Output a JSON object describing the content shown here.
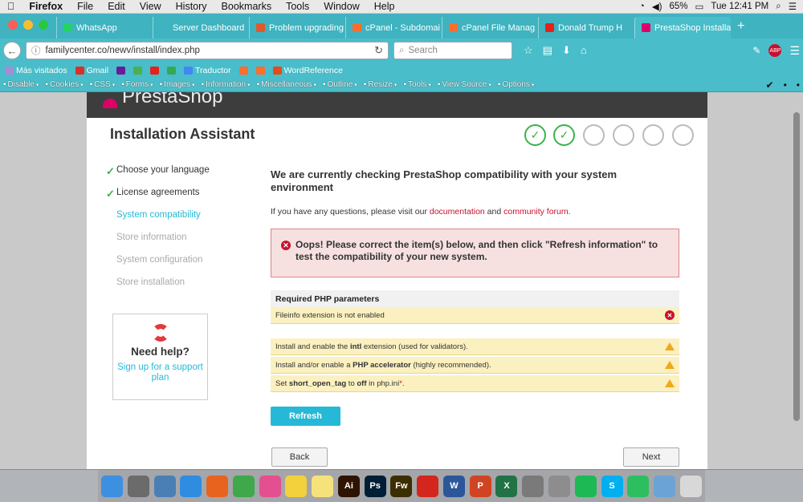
{
  "menubar": {
    "app": "Firefox",
    "items": [
      "File",
      "Edit",
      "View",
      "History",
      "Bookmarks",
      "Tools",
      "Window",
      "Help"
    ],
    "battery": "65%",
    "clock": "Tue 12:41 PM"
  },
  "tabs": [
    {
      "label": "WhatsApp",
      "color": "#25d366"
    },
    {
      "label": "Server Dashboard",
      "color": ""
    },
    {
      "label": "Problem upgrading",
      "color": "#de5a2c"
    },
    {
      "label": "cPanel - Subdomai",
      "color": "#ff6c2c"
    },
    {
      "label": "cPanel File Manag",
      "color": "#ff6c2c"
    },
    {
      "label": "Donald Trump H",
      "color": "#e62117"
    },
    {
      "label": "PrestaShop Installa",
      "color": "#df0067"
    }
  ],
  "navbar": {
    "url": "familycenter.co/newv/install/index.php",
    "search_placeholder": "Search"
  },
  "bookmarks": [
    {
      "label": "Más visitados",
      "color": "#a88bd8"
    },
    {
      "label": "Gmail",
      "color": "#d93025"
    },
    {
      "label": "",
      "color": "#6a1b9a"
    },
    {
      "label": "",
      "color": "#4caf50"
    },
    {
      "label": "",
      "color": "#e62117"
    },
    {
      "label": "",
      "color": "#34a853"
    },
    {
      "label": "Traductor",
      "color": "#4285f4"
    },
    {
      "label": "",
      "color": "#ff6c2c"
    },
    {
      "label": "",
      "color": "#ff6c2c"
    },
    {
      "label": "WordReference",
      "color": "#e64a19"
    }
  ],
  "devbar": [
    "Disable",
    "Cookies",
    "CSS",
    "Forms",
    "Images",
    "Information",
    "Miscellaneous",
    "Outline",
    "Resize",
    "Tools",
    "View Source",
    "Options"
  ],
  "installer": {
    "logo": "PrestaShop",
    "title": "Installation Assistant",
    "steps": [
      {
        "label": "Choose your language",
        "status": "done"
      },
      {
        "label": "License agreements",
        "status": "done"
      },
      {
        "label": "System compatibility",
        "status": "current"
      },
      {
        "label": "Store information",
        "status": "pending"
      },
      {
        "label": "System configuration",
        "status": "pending"
      },
      {
        "label": "Store installation",
        "status": "pending"
      }
    ],
    "check_mark": "✓",
    "help": {
      "title": "Need help?",
      "link": "Sign up for a support plan"
    },
    "heading": "We are currently checking PrestaShop compatibility with your system environment",
    "intro": {
      "prefix": "If you have any questions, please visit our ",
      "doc": "documentation",
      "mid": " and ",
      "forum": "community forum",
      "suffix": "."
    },
    "error": "Oops! Please correct the item(s) below, and then click \"Refresh information\" to test the compatibility of your new system.",
    "required_header": "Required PHP parameters",
    "required_row": "Fileinfo extension is not enabled",
    "warnings": [
      {
        "pre": "Install and enable the ",
        "bold": "intl",
        "post": " extension (used for validators)."
      },
      {
        "pre": "Install and/or enable a ",
        "bold": "PHP accelerator",
        "post": " (highly recommended)."
      },
      {
        "pre": "Set ",
        "bold": "short_open_tag",
        "mid": " to ",
        "bold2": "off",
        "post": " in php.ini",
        "star": "*",
        "end": "."
      }
    ],
    "refresh": "Refresh",
    "back": "Back",
    "next": "Next"
  },
  "dock": [
    {
      "name": "finder",
      "color": "#3d8fe0",
      "text": ""
    },
    {
      "name": "textedit",
      "color": "#6b6b6b",
      "text": ""
    },
    {
      "name": "preview",
      "color": "#4a7fb5",
      "text": ""
    },
    {
      "name": "safari",
      "color": "#2f8ce0",
      "text": ""
    },
    {
      "name": "firefox",
      "color": "#e8631d",
      "text": ""
    },
    {
      "name": "chrome",
      "color": "#3ea84b",
      "text": ""
    },
    {
      "name": "itunes",
      "color": "#e44f8f",
      "text": ""
    },
    {
      "name": "stickies",
      "color": "#f2d13c",
      "text": ""
    },
    {
      "name": "notes",
      "color": "#f5e27a",
      "text": ""
    },
    {
      "name": "illustrator",
      "color": "#2e1400",
      "text": "Ai"
    },
    {
      "name": "photoshop",
      "color": "#001e36",
      "text": "Ps"
    },
    {
      "name": "fireworks",
      "color": "#3d2e00",
      "text": "Fw"
    },
    {
      "name": "acrobat",
      "color": "#d4261c",
      "text": ""
    },
    {
      "name": "word",
      "color": "#2b579a",
      "text": "W"
    },
    {
      "name": "powerpoint",
      "color": "#d04423",
      "text": "P"
    },
    {
      "name": "excel",
      "color": "#217346",
      "text": "X"
    },
    {
      "name": "preferences",
      "color": "#7a7a7a",
      "text": ""
    },
    {
      "name": "launchpad",
      "color": "#8d8d8d",
      "text": ""
    },
    {
      "name": "spotify",
      "color": "#1db954",
      "text": ""
    },
    {
      "name": "skype",
      "color": "#00aff0",
      "text": "S"
    },
    {
      "name": "evernote",
      "color": "#2dbe60",
      "text": ""
    },
    {
      "name": "downloads",
      "color": "#6ba3d6",
      "text": ""
    },
    {
      "name": "trash",
      "color": "#d8d8d8",
      "text": ""
    }
  ]
}
